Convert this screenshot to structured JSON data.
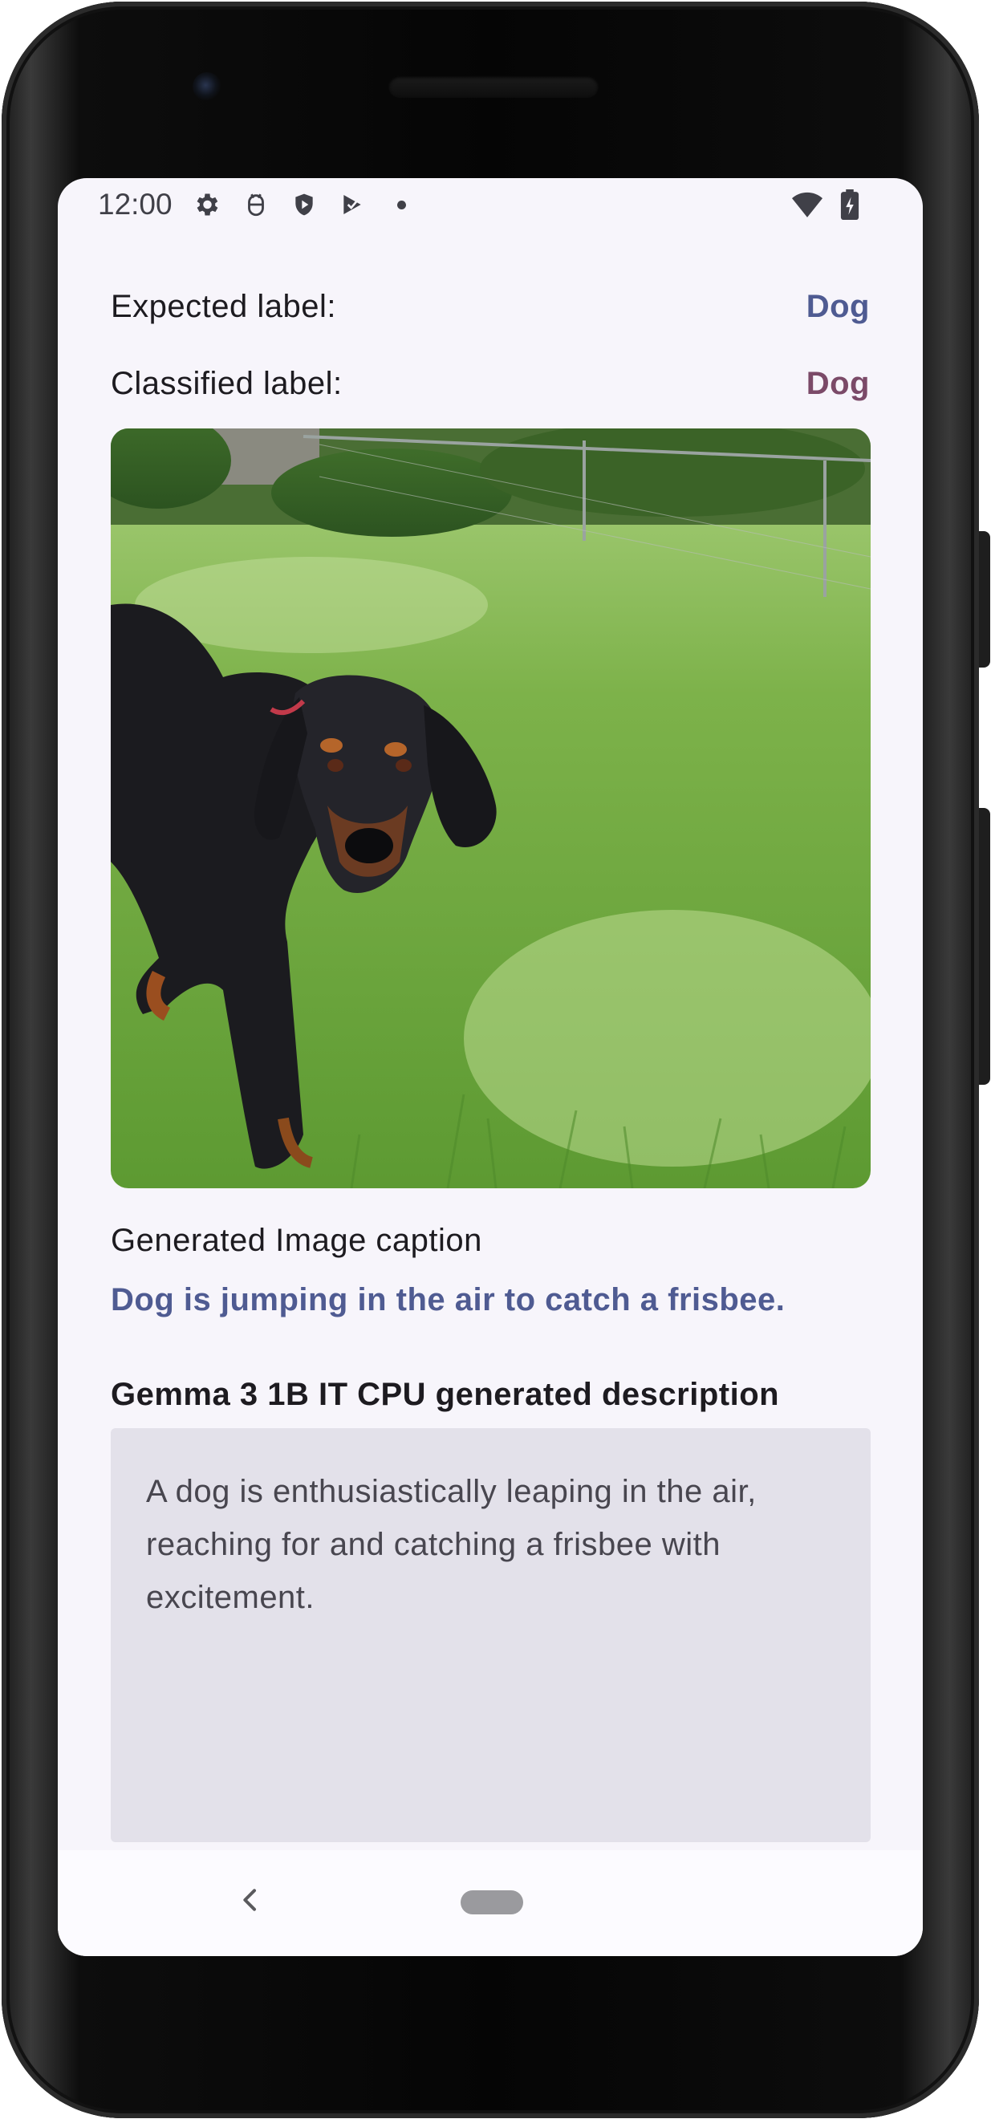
{
  "status_bar": {
    "time": "12:00",
    "icons": [
      "settings-icon",
      "android-debug-icon",
      "shield-icon",
      "play-protect-icon",
      "dot-icon",
      "wifi-icon",
      "battery-charging-icon"
    ]
  },
  "labels": {
    "expected_label_caption": "Expected label:",
    "expected_label_value": "Dog",
    "classified_label_caption": "Classified label:",
    "classified_label_value": "Dog"
  },
  "image": {
    "subject": "dog-photo"
  },
  "caption": {
    "title": "Generated Image caption",
    "text": "Dog is jumping in the air to catch a frisbee."
  },
  "description": {
    "title": "Gemma 3 1B IT CPU generated description",
    "text": "A dog is enthusiastically leaping in the air, reaching for and catching a frisbee with excitement."
  },
  "colors": {
    "expected_value": "#4f5b92",
    "classified_value": "#7b4a68",
    "caption_text": "#4f5b92",
    "screen_background": "#f7f5fb",
    "description_box": "#e3e1ea"
  },
  "nav_bar": {
    "icons": [
      "back-icon",
      "home-pill-icon"
    ]
  }
}
